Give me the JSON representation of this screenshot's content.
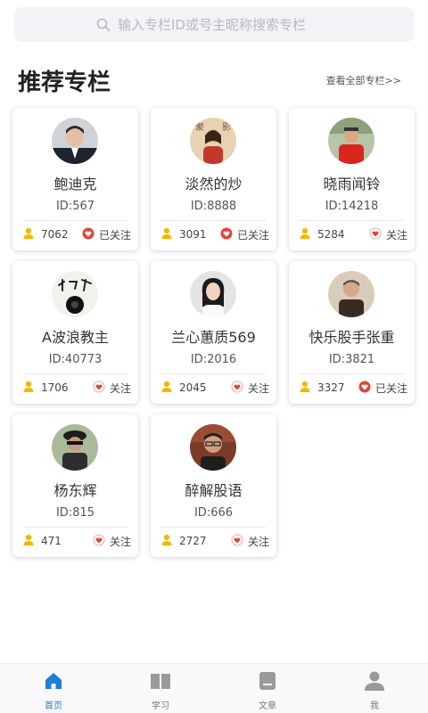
{
  "search": {
    "placeholder": "输入专栏ID或号主昵称搜索专栏"
  },
  "section": {
    "title": "推荐专栏",
    "see_all": "查看全部专栏>>"
  },
  "colors": {
    "accent": "#1e7fd6",
    "fans_icon": "#f2b800",
    "follow_heart": "#e0443b"
  },
  "columns": [
    {
      "name": "鲍迪克",
      "id_label": "ID:567",
      "fans": "7062",
      "follow_label": "已关注",
      "followed": true,
      "avatar": "avatar-photo-man-suit"
    },
    {
      "name": "淡然的炒",
      "id_label": "ID:8888",
      "fans": "3091",
      "follow_label": "已关注",
      "followed": true,
      "avatar": "avatar-photo-woman-calligraphy"
    },
    {
      "name": "晓雨闻铃",
      "id_label": "ID:14218",
      "fans": "5284",
      "follow_label": "关注",
      "followed": false,
      "avatar": "avatar-photo-man-red"
    },
    {
      "name": "A波浪教主",
      "id_label": "ID:40773",
      "fans": "1706",
      "follow_label": "关注",
      "followed": false,
      "avatar": "avatar-calligraphy-logo"
    },
    {
      "name": "兰心蕙质569",
      "id_label": "ID:2016",
      "fans": "2045",
      "follow_label": "关注",
      "followed": false,
      "avatar": "avatar-photo-woman"
    },
    {
      "name": "快乐股手张重",
      "id_label": "ID:3821",
      "fans": "3327",
      "follow_label": "已关注",
      "followed": true,
      "avatar": "avatar-photo-old-man"
    },
    {
      "name": "杨东辉",
      "id_label": "ID:815",
      "fans": "471",
      "follow_label": "关注",
      "followed": false,
      "avatar": "avatar-photo-man-cap"
    },
    {
      "name": "醉解股语",
      "id_label": "ID:666",
      "fans": "2727",
      "follow_label": "关注",
      "followed": false,
      "avatar": "avatar-photo-man-glasses"
    }
  ],
  "tabbar": [
    {
      "label": "首页",
      "icon": "home-icon",
      "active": true
    },
    {
      "label": "学习",
      "icon": "book-icon",
      "active": false
    },
    {
      "label": "文章",
      "icon": "article-icon",
      "active": false
    },
    {
      "label": "我",
      "icon": "user-icon",
      "active": false
    }
  ]
}
